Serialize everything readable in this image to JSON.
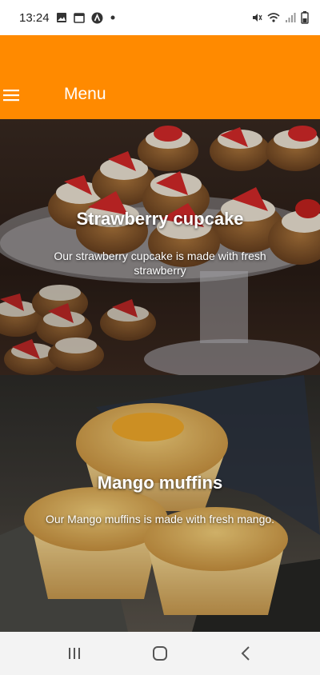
{
  "status_bar": {
    "time": "13:24",
    "left_icons": [
      "image-icon",
      "calendar-icon",
      "app-icon",
      "dot-icon"
    ],
    "right_icons": [
      "mute-icon",
      "wifi-icon",
      "signal-icon",
      "battery-icon"
    ]
  },
  "app_bar": {
    "title": "Menu",
    "color": "#ff8a00",
    "menu_icon": "hamburger-icon"
  },
  "items": [
    {
      "title": "Strawberry cupcake",
      "description": "Our strawberry cupcake is made with fresh strawberry",
      "image": "strawberry-cupcakes-photo"
    },
    {
      "title": "Mango muffins",
      "description": "Our Mango muffins is made with fresh mango.",
      "image": "mango-muffins-photo"
    }
  ],
  "nav_bar": {
    "buttons": [
      "recents-icon",
      "home-icon",
      "back-icon"
    ]
  }
}
